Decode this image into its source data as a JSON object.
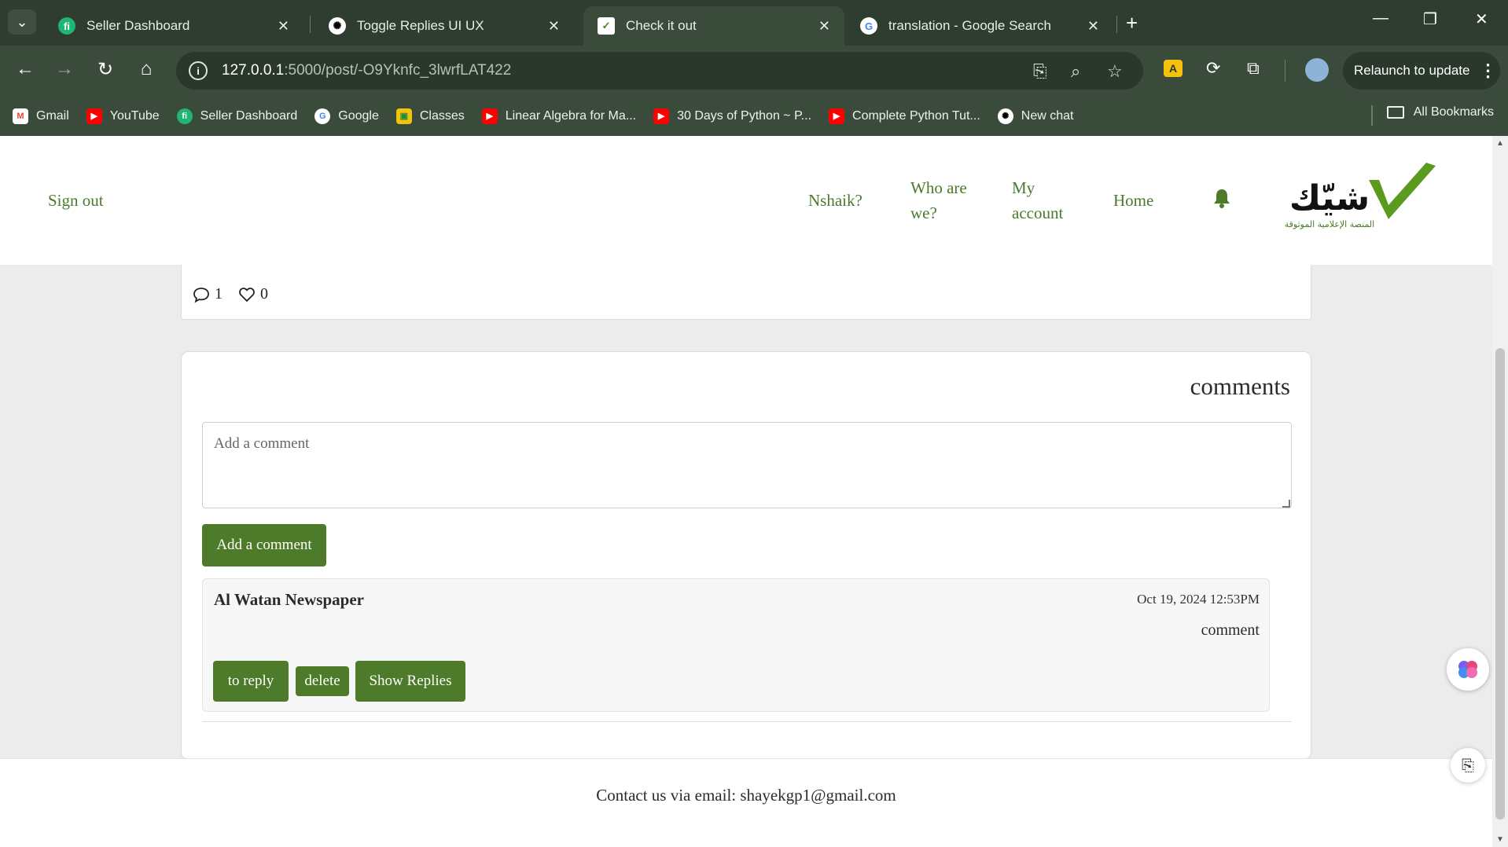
{
  "browser": {
    "tabs": [
      {
        "title": "Seller Dashboard",
        "favicon": "seller-dashboard-icon",
        "active": false
      },
      {
        "title": "Toggle Replies UI UX",
        "favicon": "chatgpt-icon",
        "active": false
      },
      {
        "title": "Check it out",
        "favicon": "site-chart-icon",
        "active": true
      },
      {
        "title": "translation - Google Search",
        "favicon": "google-icon",
        "active": false
      }
    ],
    "url_host": "127.0.0.1",
    "url_path": ":5000/post/-O9Yknfc_3lwrfLAT422",
    "relaunch_label": "Relaunch to update",
    "bookmarks": [
      {
        "label": "Gmail",
        "icon": "gmail-icon"
      },
      {
        "label": "YouTube",
        "icon": "youtube-icon"
      },
      {
        "label": "Seller Dashboard",
        "icon": "seller-dashboard-icon"
      },
      {
        "label": "Google",
        "icon": "google-icon"
      },
      {
        "label": "Classes",
        "icon": "classroom-icon"
      },
      {
        "label": "Linear Algebra for Ma...",
        "icon": "youtube-icon"
      },
      {
        "label": "30 Days of Python ~ P...",
        "icon": "youtube-icon"
      },
      {
        "label": "Complete Python Tut...",
        "icon": "youtube-icon"
      },
      {
        "label": "New chat",
        "icon": "chatgpt-icon"
      }
    ],
    "all_bookmarks_label": "All Bookmarks"
  },
  "site": {
    "nav": {
      "sign_out": "Sign out",
      "nshaik": "Nshaik?",
      "who_are_we_1": "Who are",
      "who_are_we_2": "we?",
      "my_account_1": "My",
      "my_account_2": "account",
      "home": "Home"
    },
    "logo_text": "شيّك",
    "logo_tagline": "المنصة الإعلامية الموثوقة",
    "accent_color": "#4d7b2a"
  },
  "post": {
    "comment_count": "1",
    "like_count": "0"
  },
  "comments": {
    "title": "comments",
    "input_placeholder": "Add a comment",
    "add_button": "Add a comment",
    "items": [
      {
        "author": "Al Watan Newspaper",
        "date": "Oct 19, 2024 12:53PM",
        "text": "comment",
        "reply_button": "to reply",
        "delete_button": "delete",
        "show_replies_button": "Show Replies"
      }
    ]
  },
  "footer": {
    "contact": "Contact us via email: shayekgp1@gmail.com"
  }
}
